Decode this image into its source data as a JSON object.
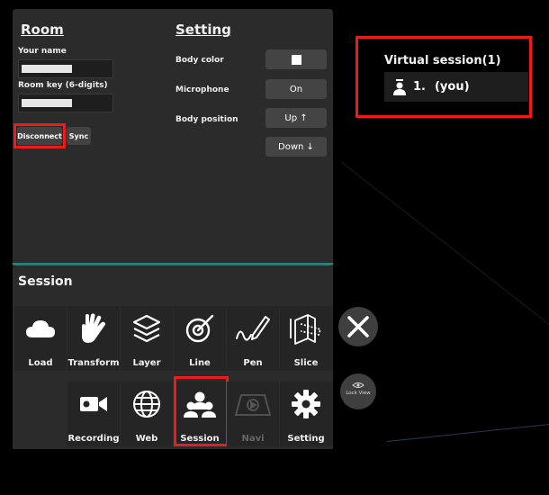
{
  "room": {
    "title": "Room",
    "your_name_label": "Your name",
    "room_key_label": "Room key (6-digits)",
    "disconnect_label": "Disconnect",
    "sync_label": "Sync"
  },
  "setting": {
    "title": "Setting",
    "body_color_label": "Body color",
    "microphone_label": "Microphone",
    "microphone_value": "On",
    "body_position_label": "Body position",
    "up_label": "Up ↑",
    "down_label": "Down ↓"
  },
  "session": {
    "title": "Session",
    "row1": [
      "Load",
      "Transform",
      "Layer",
      "Line",
      "Pen",
      "Slice"
    ],
    "row2": [
      "Recording",
      "Web",
      "Session",
      "Navi",
      "Setting"
    ],
    "lock_view_label": "Lock View"
  },
  "virtual_session": {
    "title": "Virtual session(1)",
    "members": [
      {
        "index": "1.",
        "name": "(you)"
      }
    ]
  },
  "colors": {
    "highlight": "#ee1b1b",
    "panel": "#2b2b2b",
    "accent_line": "#2d7a78"
  }
}
